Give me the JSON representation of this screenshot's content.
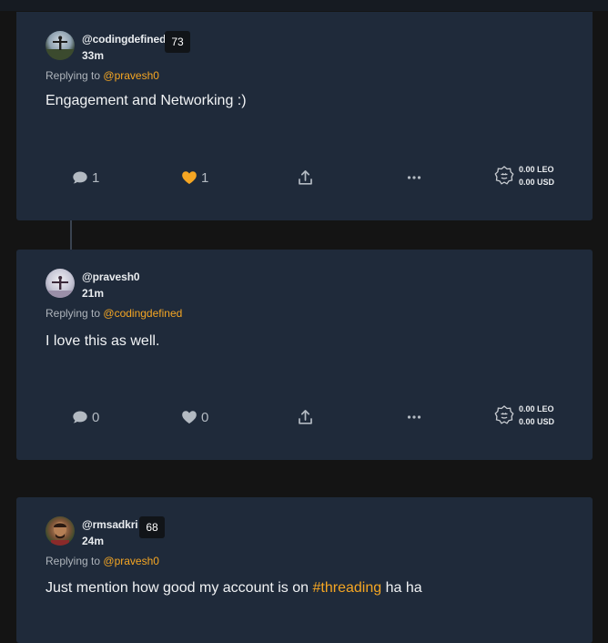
{
  "posts": [
    {
      "username": "@codingdefined",
      "reputation": "73",
      "time": "33m",
      "replying_prefix": "Replying to",
      "replying_to": "@pravesh0",
      "body": "Engagement and Networking :)",
      "comments": "1",
      "likes": "1",
      "liked": true,
      "leo": "0.00 LEO",
      "usd": "0.00 USD"
    },
    {
      "username": "@pravesh0",
      "time": "21m",
      "replying_prefix": "Replying to",
      "replying_to": "@codingdefined",
      "body": "I love this as well.",
      "comments": "0",
      "likes": "0",
      "liked": false,
      "leo": "0.00 LEO",
      "usd": "0.00 USD"
    },
    {
      "username": "@rmsadkri",
      "reputation": "68",
      "time": "24m",
      "replying_prefix": "Replying to",
      "replying_to": "@pravesh0",
      "body_before": "Just mention how good my account is on ",
      "hashtag": "#threading",
      "body_after": " ha ha"
    }
  ],
  "colors": {
    "accent": "#f5a623",
    "card": "#1f2a3a",
    "background": "#141414"
  },
  "icons": [
    "comment-icon",
    "heart-icon",
    "share-icon",
    "more-icon",
    "leo-lion-icon"
  ]
}
